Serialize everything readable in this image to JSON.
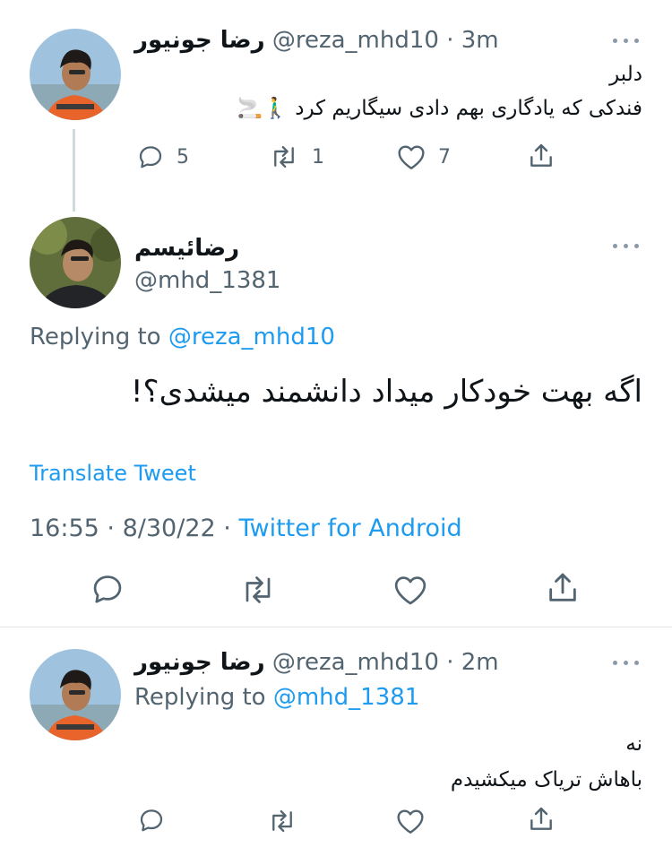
{
  "thread": {
    "parent": {
      "display_name": "رضا جونیور",
      "handle": "@reza_mhd10",
      "time": "· 3m",
      "text_line1": "دلبر",
      "text_line2": "فندکی که یادگاری بهم دادی سیگاریم کرد 🚶‍♂️🚬",
      "replies": "5",
      "retweets": "1",
      "likes": "7"
    },
    "main": {
      "display_name": "رضائیسم",
      "handle": "@mhd_1381",
      "replying_prefix": "Replying to",
      "replying_to": "@reza_mhd10",
      "text": "اگه بهت خودکار میداد دانشمند میشدی؟!",
      "translate": "Translate Tweet",
      "time": "16:55",
      "date": "8/30/22",
      "source": "Twitter for Android"
    },
    "reply": {
      "display_name": "رضا جونیور",
      "handle": "@reza_mhd10",
      "time": "· 2m",
      "replying_prefix": "Replying to",
      "replying_to": "@mhd_1381",
      "text_line1": "نه",
      "text_line2": "باهاش تریاک میکشیدم"
    },
    "separator": "·"
  },
  "colors": {
    "accent": "#1d9bf0",
    "secondary_text": "#536471",
    "primary_text": "#0f1419",
    "divider": "#e1e5e8"
  },
  "icons": [
    "reply-icon",
    "retweet-icon",
    "like-icon",
    "share-icon",
    "more-icon"
  ]
}
